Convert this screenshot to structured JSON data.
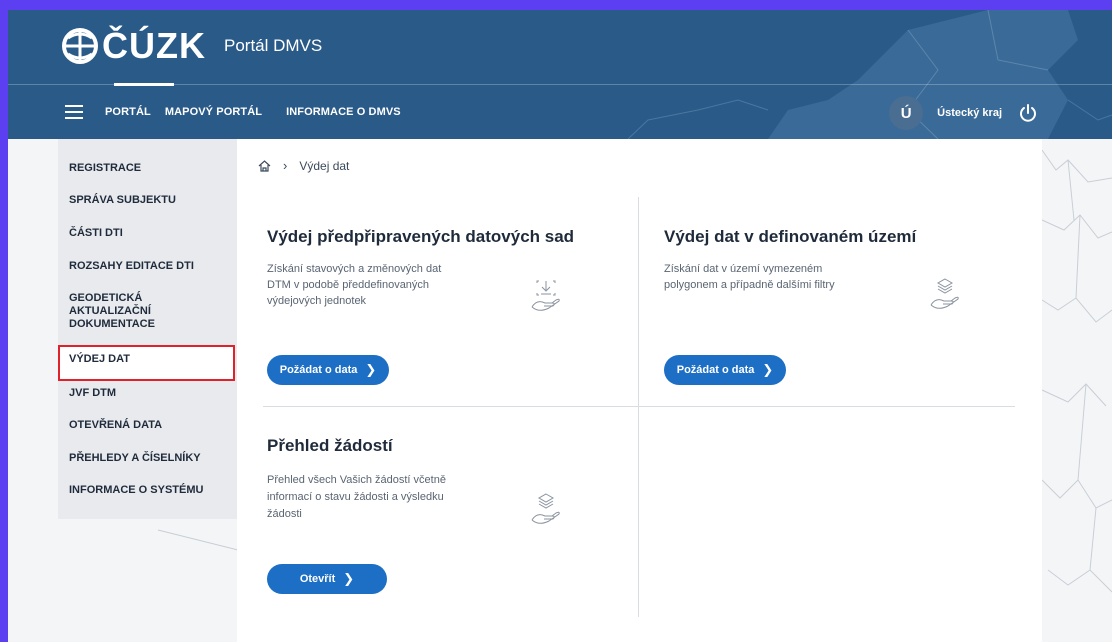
{
  "header": {
    "logo_text": "ČÚZK",
    "portal_title": "Portál DMVS",
    "nav": [
      "PORTÁL",
      "MAPOVÝ PORTÁL",
      "INFORMACE O DMVS"
    ],
    "user_initial": "Ú",
    "region": "Ústecký kraj"
  },
  "sidebar": {
    "items": [
      "REGISTRACE",
      "SPRÁVA SUBJEKTU",
      "ČÁSTI DTI",
      "ROZSAHY EDITACE DTI",
      "GEODETICKÁ AKTUALIZAČNÍ DOKUMENTACE",
      "VÝDEJ DAT",
      "JVF DTM",
      "OTEVŘENÁ DATA",
      "PŘEHLEDY A ČÍSELNÍKY",
      "INFORMACE O SYSTÉMU"
    ],
    "active": "VÝDEJ DAT"
  },
  "breadcrumb": {
    "current": "Výdej dat"
  },
  "cards": [
    {
      "title": "Výdej předpřipravených datových sad",
      "text_lines": [
        "Získání stavových a změnových dat",
        "DTM v podobě předdefinovaných",
        "výdejových jednotek"
      ],
      "button": "Požádat o data"
    },
    {
      "title": "Výdej dat v definovaném území",
      "text_lines": [
        "Získání dat v území vymezeném",
        "polygonem a případně dalšími filtry"
      ],
      "button": "Požádat o data"
    },
    {
      "title": "Přehled žádostí",
      "text_lines": [
        "Přehled všech Vašich žádostí včetně",
        "informací o stavu žádosti a výsledku",
        "žádosti"
      ],
      "button": "Otevřít"
    }
  ],
  "colors": {
    "outer_frame": "#5b3ff0",
    "header": "#2a5a88",
    "button": "#1d6fc6",
    "active_outline": "#e0202a"
  }
}
